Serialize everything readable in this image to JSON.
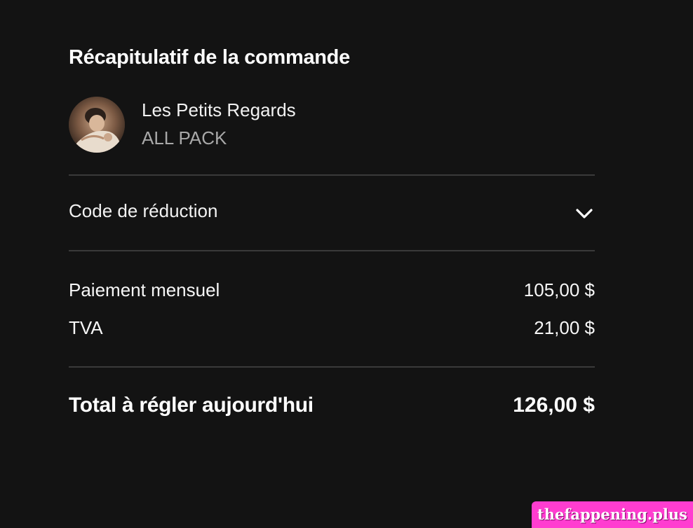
{
  "summary": {
    "title": "Récapitulatif de la commande"
  },
  "creator": {
    "name": "Les Petits Regards",
    "plan": "ALL PACK",
    "avatar_icon": "creator-avatar"
  },
  "discount": {
    "label": "Code de réduction",
    "toggle_icon": "chevron-down-icon"
  },
  "lines": [
    {
      "label": "Paiement mensuel",
      "value": "105,00 $"
    },
    {
      "label": "TVA",
      "value": "21,00 $"
    }
  ],
  "total": {
    "label": "Total à régler aujourd'hui",
    "value": "126,00 $"
  },
  "watermark": {
    "text": "thefappening.plus"
  },
  "colors": {
    "background": "#131313",
    "text_primary": "#ffffff",
    "text_secondary": "#a8a8a8",
    "divider": "#3a3a3a",
    "watermark_bg": "#ff3dd0"
  }
}
